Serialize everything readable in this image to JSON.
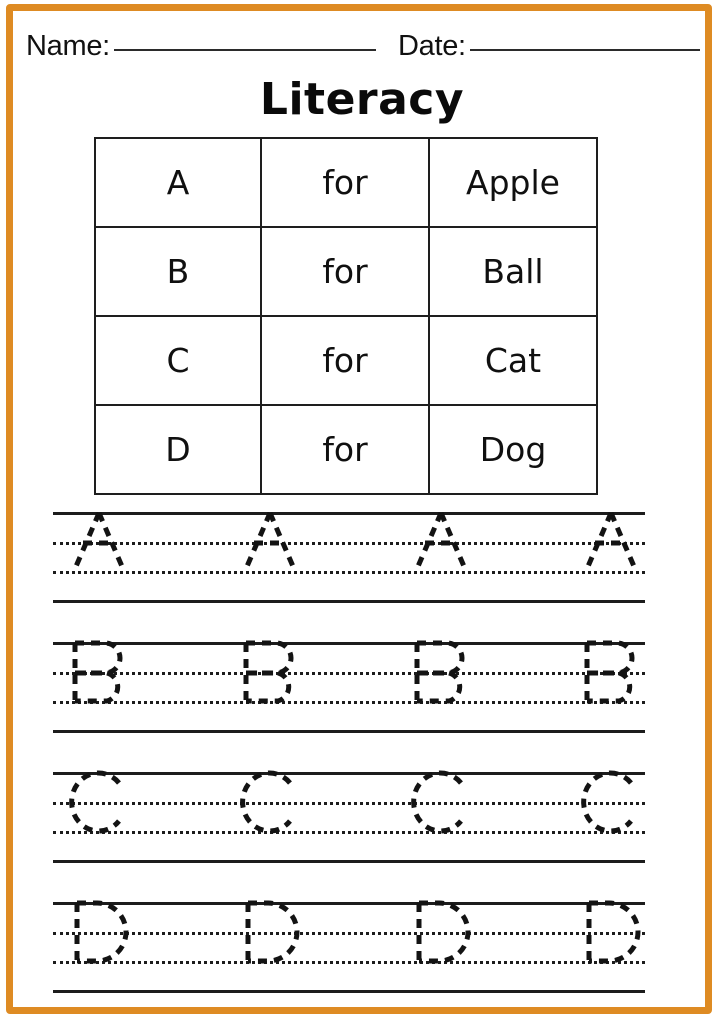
{
  "page": {
    "title": "Literacy",
    "border_color": "#DE8B23",
    "ink_color": "#131313"
  },
  "header": {
    "name_label": "Name:",
    "date_label": "Date:",
    "name_value": "",
    "date_value": ""
  },
  "letter_table": {
    "rows": [
      {
        "letter": "A",
        "connector": "for",
        "word": "Apple"
      },
      {
        "letter": "B",
        "connector": "for",
        "word": "Ball"
      },
      {
        "letter": "C",
        "connector": "for",
        "word": "Cat"
      },
      {
        "letter": "D",
        "connector": "for",
        "word": "Dog"
      }
    ]
  },
  "tracing": {
    "repeats_per_row": 4,
    "line_style": [
      "solid",
      "dotted",
      "dotted",
      "solid"
    ],
    "rows": [
      {
        "letter": "A",
        "label": "trace-row-A"
      },
      {
        "letter": "B",
        "label": "trace-row-B"
      },
      {
        "letter": "C",
        "label": "trace-row-C"
      },
      {
        "letter": "D",
        "label": "trace-row-D"
      }
    ]
  }
}
